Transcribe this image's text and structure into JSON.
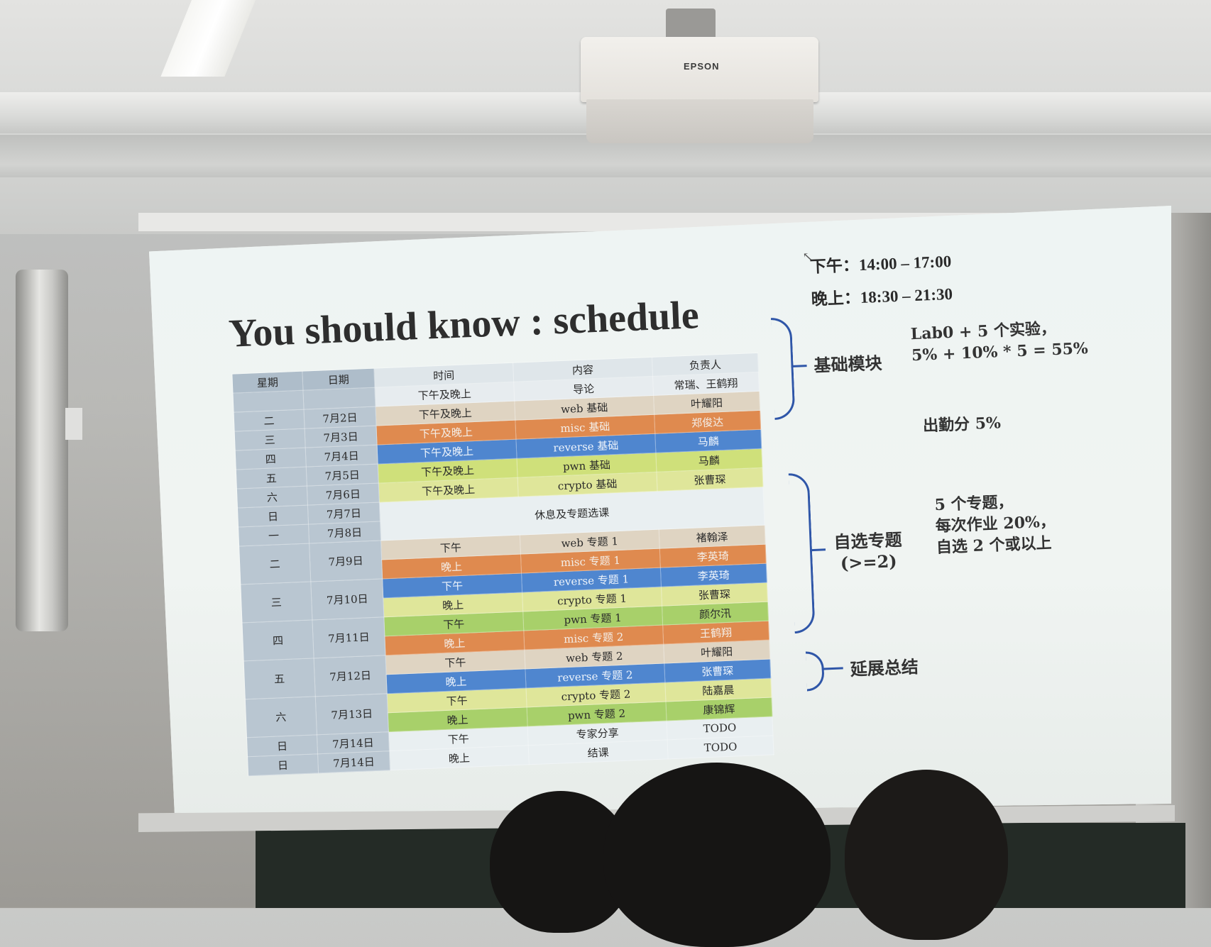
{
  "slide": {
    "title": "You should know : schedule",
    "afternoon_time": "下午：14:00 – 17:00",
    "evening_time": "晚上：18:30 – 21:30"
  },
  "table": {
    "headers": {
      "weekday": "星期",
      "date": "日期",
      "time": "时间",
      "content": "内容",
      "owner": "负责人"
    },
    "rows": [
      {
        "weekday": "",
        "date": "",
        "time": "下午及晚上",
        "content": "导论",
        "owner": "常瑞、王鹤翔",
        "color": "white"
      },
      {
        "weekday": "二",
        "date": "7月2日",
        "time": "下午及晚上",
        "content": "web 基础",
        "owner": "叶耀阳",
        "color": "beige"
      },
      {
        "weekday": "三",
        "date": "7月3日",
        "time": "下午及晚上",
        "content": "misc 基础",
        "owner": "郑俊达",
        "color": "orange"
      },
      {
        "weekday": "四",
        "date": "7月4日",
        "time": "下午及晚上",
        "content": "reverse 基础",
        "owner": "马麟",
        "color": "blue"
      },
      {
        "weekday": "五",
        "date": "7月5日",
        "time": "下午及晚上",
        "content": "pwn 基础",
        "owner": "马麟",
        "color": "lime"
      },
      {
        "weekday": "六",
        "date": "7月6日",
        "time": "下午及晚上",
        "content": "crypto 基础",
        "owner": "张曹琛",
        "color": "yellow"
      },
      {
        "weekday": "日",
        "date": "7月7日",
        "time": "",
        "content": "",
        "owner": "",
        "color": "rest"
      }
    ],
    "rest_label": "休息及专题选课",
    "rows2": [
      {
        "weekday": "一",
        "date": "7月8日",
        "time": "",
        "content": "",
        "owner": "",
        "color": "rest"
      },
      {
        "time": "下午",
        "content": "web 专题 1",
        "owner": "褚翰泽",
        "color": "beige"
      },
      {
        "time": "晚上",
        "content": "misc 专题 1",
        "owner": "李英琦",
        "color": "orange"
      },
      {
        "time": "下午",
        "content": "reverse 专题 1",
        "owner": "李英琦",
        "color": "blue"
      },
      {
        "time": "晚上",
        "content": "crypto 专题 1",
        "owner": "张曹琛",
        "color": "yellow"
      },
      {
        "time": "下午",
        "content": "pwn 专题 1",
        "owner": "颜尔汛",
        "color": "green"
      },
      {
        "time": "晚上",
        "content": "misc 专题 2",
        "owner": "王鹤翔",
        "color": "orange"
      },
      {
        "time": "下午",
        "content": "web 专题 2",
        "owner": "叶耀阳",
        "color": "beige"
      },
      {
        "time": "晚上",
        "content": "reverse 专题 2",
        "owner": "张曹琛",
        "color": "blue"
      },
      {
        "time": "下午",
        "content": "crypto 专题 2",
        "owner": "陆嘉晨",
        "color": "yellow"
      },
      {
        "time": "晚上",
        "content": "pwn 专题 2",
        "owner": "康锦辉",
        "color": "green"
      },
      {
        "time": "下午",
        "content": "专家分享",
        "owner": "TODO",
        "color": "rest"
      },
      {
        "time": "晚上",
        "content": "结课",
        "owner": "TODO",
        "color": "rest"
      }
    ],
    "day_labels": [
      {
        "weekday": "二",
        "date": "7月9日"
      },
      {
        "weekday": "三",
        "date": "7月10日"
      },
      {
        "weekday": "四",
        "date": "7月11日"
      },
      {
        "weekday": "五",
        "date": "7月12日"
      },
      {
        "weekday": "六",
        "date": "7月13日"
      },
      {
        "weekday": "日",
        "date": "7月14日"
      },
      {
        "weekday": "日",
        "date": "7月14日"
      }
    ]
  },
  "annotations": {
    "basic_module": "基础模块",
    "basic_note_1": "Lab0 + 5 个实验，",
    "basic_note_2": "5% + 10% * 5 = 55%",
    "attendance": "出勤分 5%",
    "elective_1": "自选专题",
    "elective_2": "(>=2)",
    "elective_note_1": "5 个专题，",
    "elective_note_2": "每次作业 20%，",
    "elective_note_3": "自选 2 个或以上",
    "extension": "延展总结"
  },
  "projector": {
    "brand": "EPSON"
  }
}
